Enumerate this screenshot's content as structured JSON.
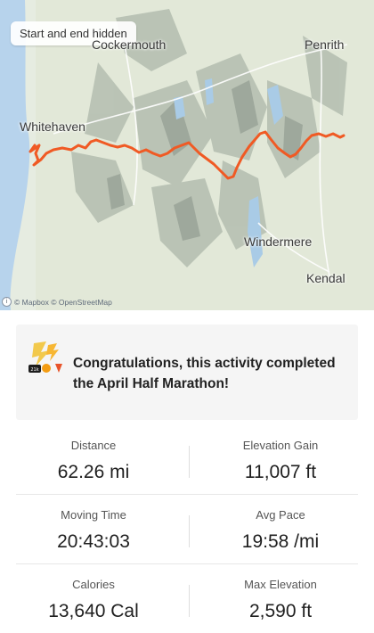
{
  "map": {
    "chip_label": "Start and end hidden",
    "places": {
      "cockermouth": "Cockermouth",
      "penrith": "Penrith",
      "whitehaven": "Whitehaven",
      "windermere": "Windermere",
      "kendal": "Kendal"
    },
    "attribution": "© Mapbox © OpenStreetMap",
    "route_color": "#f05a24"
  },
  "achievement": {
    "text": "Congratulations, this activity completed the April Half Marathon!"
  },
  "stats": [
    {
      "label": "Distance",
      "value": "62.26 mi"
    },
    {
      "label": "Elevation Gain",
      "value": "11,007 ft"
    },
    {
      "label": "Moving Time",
      "value": "20:43:03"
    },
    {
      "label": "Avg Pace",
      "value": "19:58 /mi"
    },
    {
      "label": "Calories",
      "value": "13,640 Cal"
    },
    {
      "label": "Max Elevation",
      "value": "2,590 ft"
    }
  ]
}
